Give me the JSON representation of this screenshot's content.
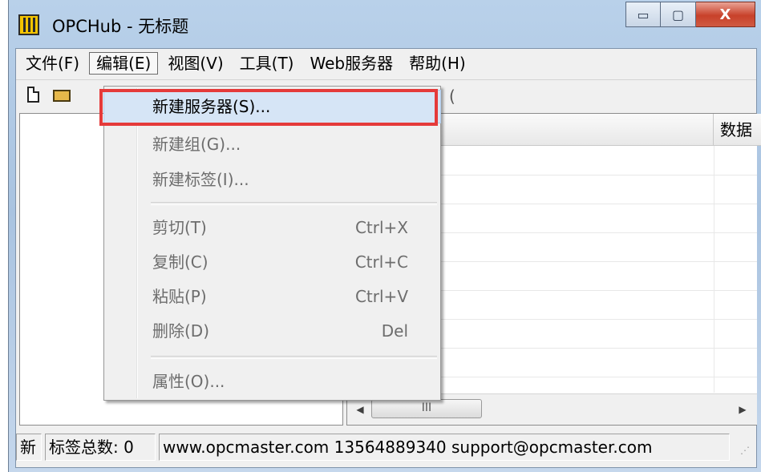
{
  "window": {
    "title": "OPCHub - 无标题",
    "minimize_glyph": "▭",
    "maximize_glyph": "▢",
    "close_glyph": "X"
  },
  "menubar": {
    "items": [
      {
        "label": "文件(F)"
      },
      {
        "label": "编辑(E)"
      },
      {
        "label": "视图(V)"
      },
      {
        "label": "工具(T)"
      },
      {
        "label": "Web服务器"
      },
      {
        "label": "帮助(H)"
      }
    ]
  },
  "toolbar": {
    "icons": [
      "new-document-icon",
      "open-folder-icon"
    ],
    "partial_glyph": "("
  },
  "list": {
    "headers": [
      "",
      "数据"
    ]
  },
  "scrollbar": {
    "left_arrow": "◀",
    "right_arrow": "▶",
    "thumb_grip": "III"
  },
  "edit_menu": {
    "items": [
      {
        "label": "新建服务器(S)...",
        "shortcut": "",
        "enabled": true,
        "highlighted": true
      },
      {
        "label": "新建组(G)...",
        "shortcut": "",
        "enabled": false
      },
      {
        "label": "新建标签(I)...",
        "shortcut": "",
        "enabled": false
      },
      {
        "label": "剪切(T)",
        "shortcut": "Ctrl+X",
        "enabled": false
      },
      {
        "label": "复制(C)",
        "shortcut": "Ctrl+C",
        "enabled": false
      },
      {
        "label": "粘贴(P)",
        "shortcut": "Ctrl+V",
        "enabled": false
      },
      {
        "label": "删除(D)",
        "shortcut": "Del",
        "enabled": false
      },
      {
        "label": "属性(O)...",
        "shortcut": "",
        "enabled": false
      }
    ]
  },
  "statusbar": {
    "pane1": "新",
    "pane2": "标签总数: 0",
    "pane3": "www.opcmaster.com 13564889340 support@opcmaster.com"
  },
  "colors": {
    "highlight_border": "#e53a3a",
    "menu_highlight": "#d6e5f6",
    "disabled_text": "#6d6d6d"
  }
}
